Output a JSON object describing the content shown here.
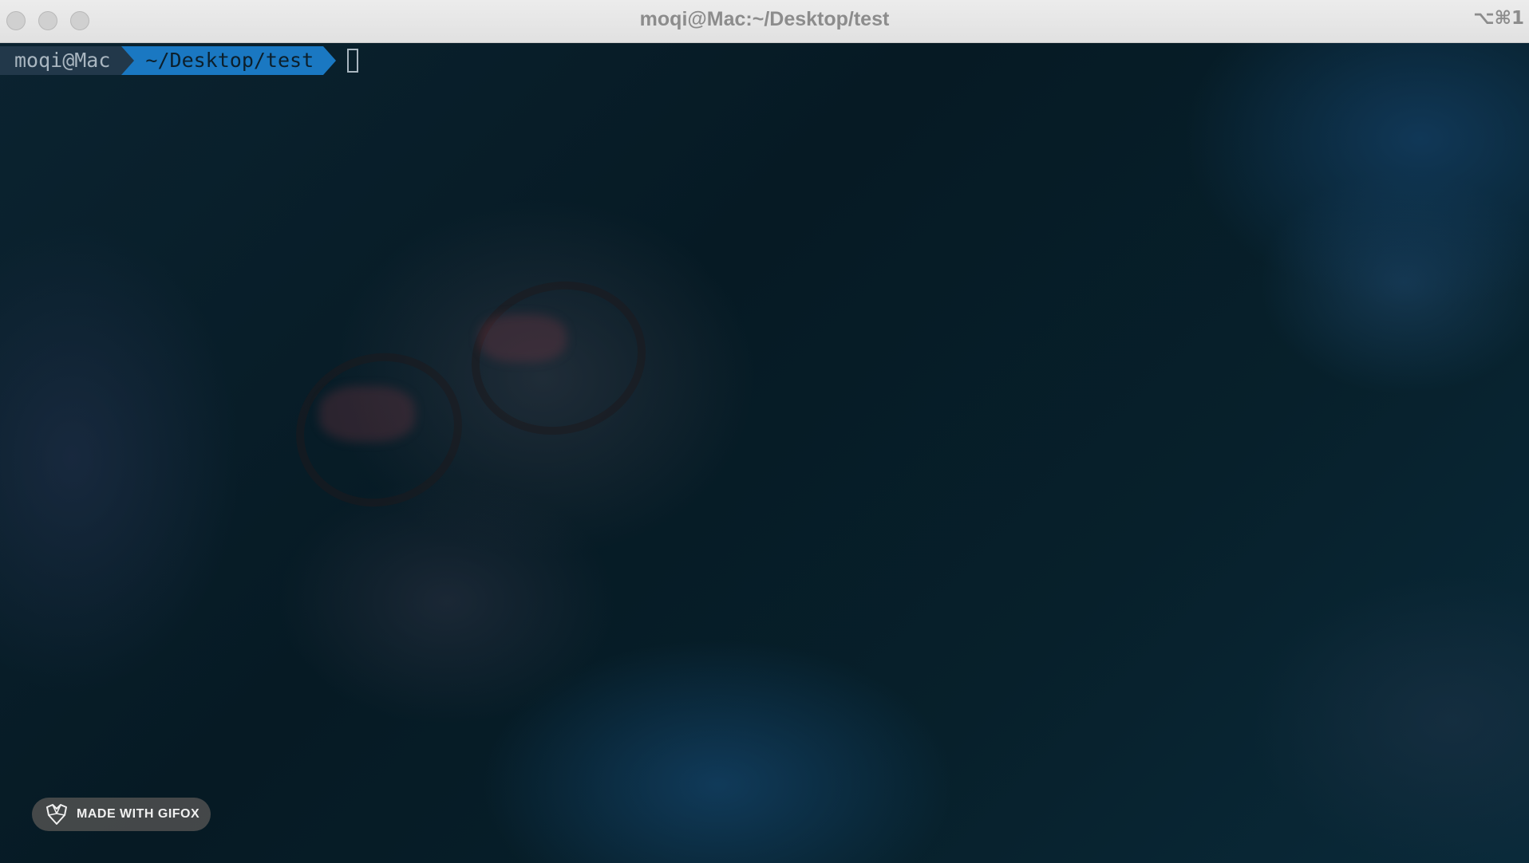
{
  "window": {
    "title": "moqi@Mac:~/Desktop/test",
    "tab_shortcut": "⌥⌘1"
  },
  "prompt": {
    "user_host": "moqi@Mac",
    "path": "~/Desktop/test"
  },
  "badge": {
    "label": "MADE WITH GIFOX",
    "icon": "gifox-fox-icon"
  },
  "colors": {
    "path_segment": "#1a78c2",
    "user_segment": "#22384a",
    "terminal_background": "#061a24"
  }
}
